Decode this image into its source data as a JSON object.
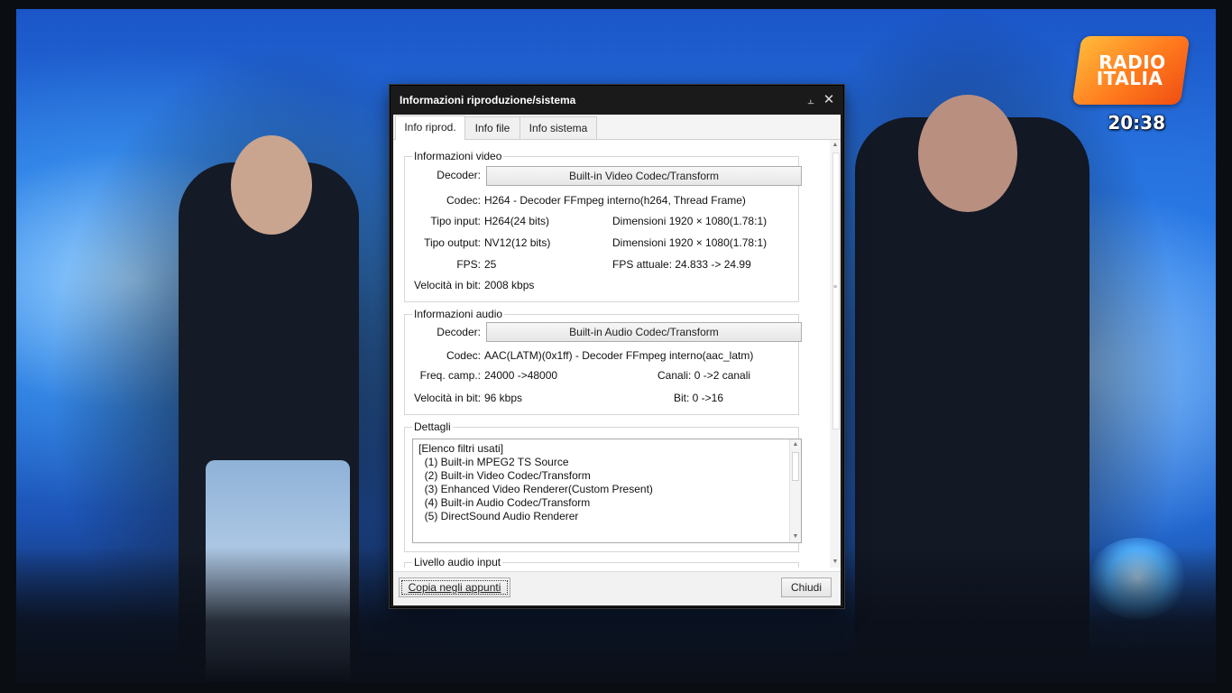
{
  "overlay": {
    "logo_line1": "RADIO",
    "logo_line2": "ITALIA",
    "clock": "20:38"
  },
  "dialog": {
    "title": "Informazioni riproduzione/sistema",
    "pin_icon": "pin-icon",
    "close_icon": "close-icon",
    "tabs": [
      {
        "label": "Info riprod.",
        "active": true
      },
      {
        "label": "Info file",
        "active": false
      },
      {
        "label": "Info sistema",
        "active": false
      }
    ],
    "video": {
      "legend": "Informazioni video",
      "decoder_label": "Decoder:",
      "decoder_value": "Built-in Video Codec/Transform",
      "codec_label": "Codec:",
      "codec_value": "H264 - Decoder FFmpeg interno(h264, Thread Frame)",
      "input_type_label": "Tipo input:",
      "input_type_value": "H264(24 bits)",
      "input_dim": "Dimensioni 1920 × 1080(1.78:1)",
      "output_type_label": "Tipo output:",
      "output_type_value": "NV12(12 bits)",
      "output_dim": "Dimensioni 1920 × 1080(1.78:1)",
      "fps_label": "FPS:",
      "fps_value": "25",
      "fps_current": "FPS attuale: 24.833 -> 24.99",
      "bitrate_label": "Velocità in bit:",
      "bitrate_value": "2008 kbps"
    },
    "audio": {
      "legend": "Informazioni audio",
      "decoder_label": "Decoder:",
      "decoder_value": "Built-in Audio Codec/Transform",
      "codec_label": "Codec:",
      "codec_value": "AAC(LATM)(0x1ff) - Decoder FFmpeg interno(aac_latm)",
      "freq_label": "Freq. camp.:",
      "freq_value": "24000 ->48000",
      "channels": "Canali: 0 ->2 canali",
      "bitrate_label": "Velocità in bit:",
      "bitrate_value": "96 kbps",
      "bits": "Bit: 0 ->16"
    },
    "details": {
      "legend": "Dettagli",
      "lines": [
        "[Elenco filtri usati]",
        "  (1) Built-in MPEG2 TS Source",
        "  (2) Built-in Video Codec/Transform",
        "  (3) Enhanced Video Renderer(Custom Present)",
        "  (4) Built-in Audio Codec/Transform",
        "  (5) DirectSound Audio Renderer"
      ]
    },
    "audio_level_legend": "Livello audio input",
    "copy_button": "Copia negli appunti",
    "close_button": "Chiudi"
  }
}
